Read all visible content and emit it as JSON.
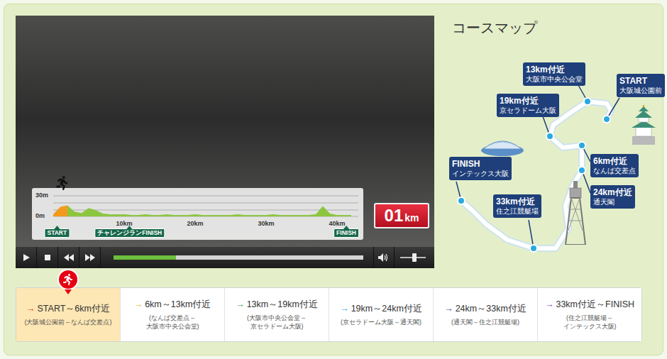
{
  "video": {
    "elevation_chart": {
      "y_ticks": [
        "30m",
        "0m"
      ],
      "x_ticks": [
        "10km",
        "20km",
        "30km",
        "40km"
      ],
      "series": [
        {
          "name": "elevation",
          "values": [
            3,
            14,
            16,
            7,
            5,
            12,
            9,
            4,
            3,
            3,
            3,
            2,
            2,
            3,
            2,
            2,
            3,
            2,
            2,
            2,
            3,
            2,
            2,
            2,
            2,
            2,
            3,
            2,
            2,
            2,
            2,
            3,
            2,
            2,
            2,
            2,
            2,
            3,
            15,
            4,
            2,
            2,
            2
          ]
        }
      ],
      "markers": [
        {
          "label": "START",
          "km": 0
        },
        {
          "label": "チャレンジランFINISH",
          "km": 8.8
        },
        {
          "label": "FINISH",
          "km": 42.2
        }
      ],
      "runner": {
        "level": 0.03
      }
    },
    "distance": {
      "value": "01",
      "unit": "km"
    },
    "controls": {
      "progress": {
        "level": 0.25
      },
      "volume": {
        "level": 0.55
      }
    }
  },
  "map": {
    "title": "コースマップ",
    "pins": [
      {
        "label": "START",
        "place": "大阪城公園前"
      },
      {
        "label": "6km付近",
        "place": "なんば交差点"
      },
      {
        "label": "13km付近",
        "place": "大阪市中央公会堂"
      },
      {
        "label": "19km付近",
        "place": "京セラドーム大阪"
      },
      {
        "label": "24km付近",
        "place": "通天閣"
      },
      {
        "label": "33km付近",
        "place": "住之江競艇場"
      },
      {
        "label": "FINISH",
        "place": "インテックス大阪"
      }
    ]
  },
  "segments": [
    {
      "arrow": "→",
      "title": "START～6km付近",
      "subtitle": [
        "(大阪城公園前～なんば交差点)"
      ],
      "color": "#e8380d",
      "selected": true
    },
    {
      "arrow": "→",
      "title": "6km～13km付近",
      "subtitle": [
        "(なんば交差点～",
        "大阪市中央公会堂)"
      ],
      "color": "#f5a31a",
      "selected": false
    },
    {
      "arrow": "→",
      "title": "13km～19km付近",
      "subtitle": [
        "(大阪市中央公会堂～",
        "京セラドーム大阪)"
      ],
      "color": "#2fa84f",
      "selected": false
    },
    {
      "arrow": "→",
      "title": "19km～24km付近",
      "subtitle": [
        "(京セラドーム大阪～通天閣)"
      ],
      "color": "#1eaed8",
      "selected": false
    },
    {
      "arrow": "→",
      "title": "24km～33km付近",
      "subtitle": [
        "(通天閣～住之江競艇場)"
      ],
      "color": "#1d4f9c",
      "selected": false
    },
    {
      "arrow": "→",
      "title": "33km付近～FINISH",
      "subtitle": [
        "(住之江競艇場～",
        "インテックス大阪)"
      ],
      "color": "#8e3fa3",
      "selected": false
    }
  ]
}
